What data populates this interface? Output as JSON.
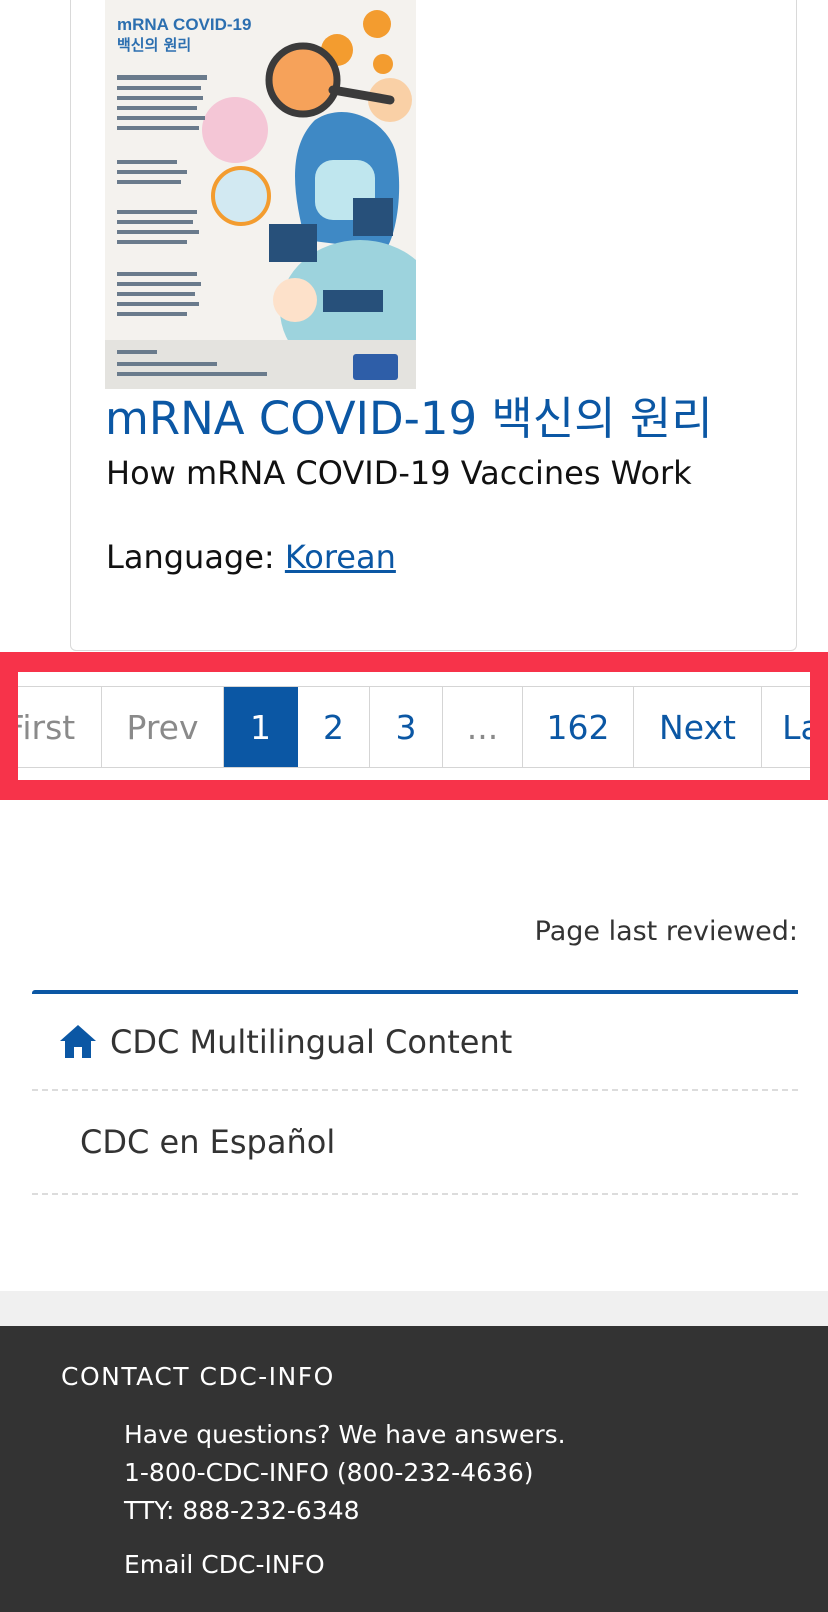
{
  "card": {
    "thumbnail": {
      "title_line1": "mRNA COVID-19",
      "title_line2": "백신의 원리",
      "icon": "cdc-logo-icon"
    },
    "title": "mRNA COVID-19 백신의 원리",
    "subtitle": "How mRNA COVID-19 Vaccines Work",
    "language_label": "Language:",
    "language_value": "Korean"
  },
  "pagination": {
    "first": "First",
    "prev": "Prev",
    "pages": [
      "1",
      "2",
      "3"
    ],
    "ellipsis": "...",
    "last_page": "162",
    "next": "Next",
    "last": "Last",
    "active_page": "1"
  },
  "page_last_reviewed": "Page last reviewed:",
  "nav": {
    "home_icon": "home-icon",
    "home_label": "CDC Multilingual Content",
    "items": [
      "CDC en Español"
    ]
  },
  "footer": {
    "heading": "CONTACT CDC-INFO",
    "lines": [
      "Have questions? We have answers.",
      "1-800-CDC-INFO (800-232-4636)",
      "TTY: 888-232-6348"
    ],
    "email_label": "Email CDC-INFO"
  },
  "colors": {
    "accent": "#0b57a4",
    "highlight": "#f7334a",
    "footer_bg": "#333333"
  }
}
